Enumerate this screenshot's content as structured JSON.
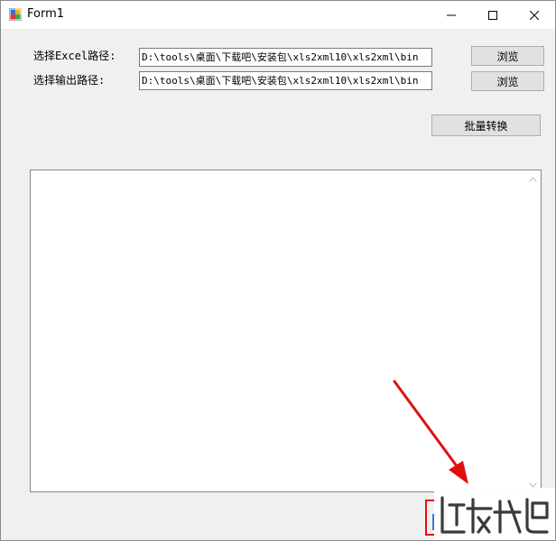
{
  "window": {
    "title": "Form1",
    "icon": "winforms-app-icon"
  },
  "caption_buttons": {
    "minimize_icon": "minimize-icon",
    "maximize_icon": "maximize-icon",
    "close_icon": "close-icon"
  },
  "form": {
    "excel_label": "选择Excel路径:",
    "excel_path": "D:\\tools\\桌面\\下载吧\\安装包\\xls2xml10\\xls2xml\\bin",
    "output_label": "选择输出路径:",
    "output_path": "D:\\tools\\桌面\\下载吧\\安装包\\xls2xml10\\xls2xml\\bin",
    "browse_label_1": "浏览",
    "browse_label_2": "浏览",
    "convert_label": "批量转换"
  },
  "log": {
    "content": ""
  },
  "annotation": {
    "arrow_color": "#e01010",
    "highlight_color": "#e01010"
  },
  "watermark": {
    "logo": "xiazaiba-logo"
  }
}
